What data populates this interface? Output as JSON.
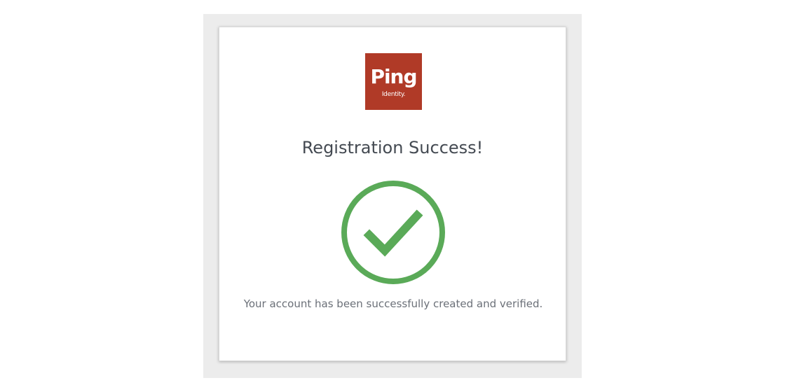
{
  "logo": {
    "word": "Ping",
    "sub": "Identity.",
    "color": "#b03a27"
  },
  "page": {
    "title": "Registration Success!",
    "message": "Your account has been successfully created and verified."
  },
  "status_icon": {
    "name": "check-circle-icon",
    "color": "#5aaa58"
  },
  "colors": {
    "background_frame": "#ececec",
    "card": "#ffffff",
    "title_text": "#444a52",
    "body_text": "#6b7078"
  }
}
